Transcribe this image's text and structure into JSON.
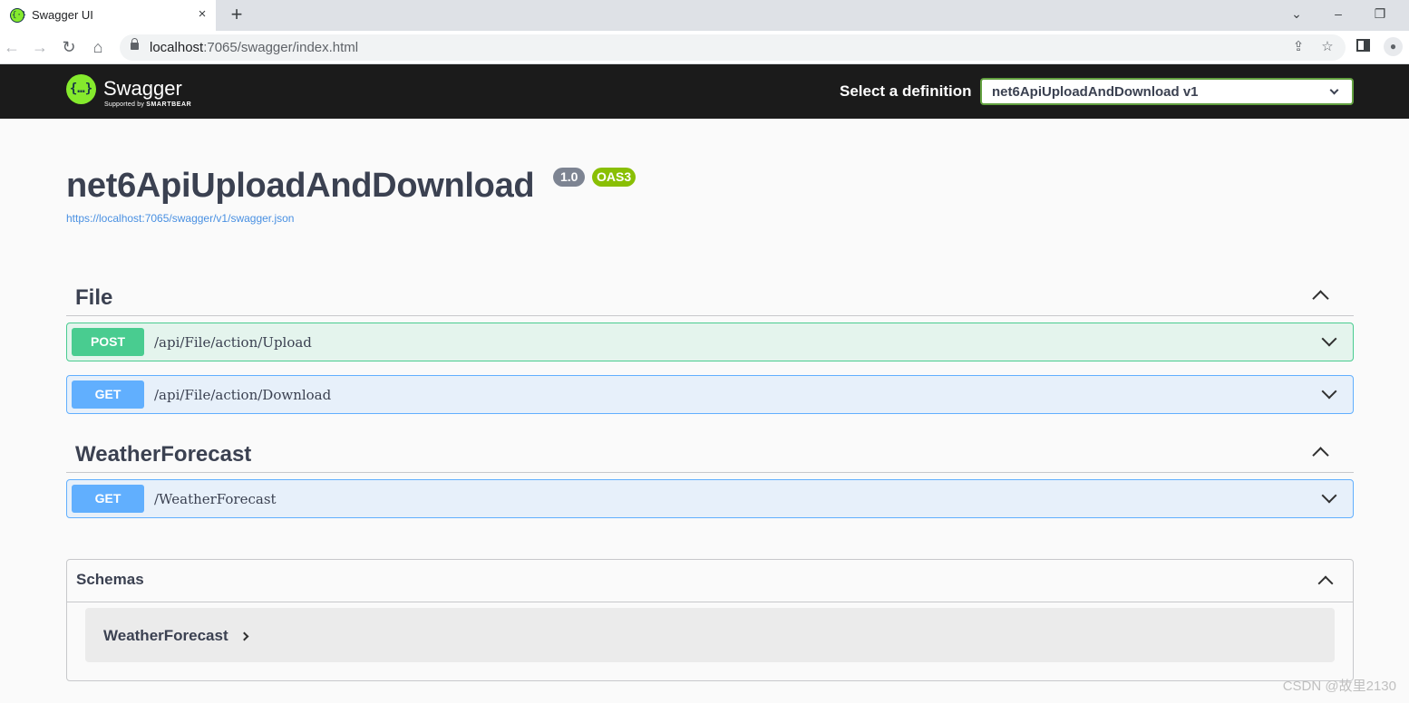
{
  "browser": {
    "tab_title": "Swagger UI",
    "tab_close": "×",
    "new_tab": "+",
    "window_controls": {
      "dropdown": "⌄",
      "minimize": "–",
      "restore": "❐"
    },
    "url_host": "localhost",
    "url_path": ":7065/swagger/index.html",
    "nav": {
      "back": "←",
      "forward": "→",
      "reload": "↻",
      "home": "⌂"
    },
    "icons": {
      "share": "⇪",
      "bookmark": "☆",
      "profile": "●"
    }
  },
  "topbar": {
    "logo_text": "Swagger",
    "logo_sub_prefix": "Supported by",
    "logo_sub_brand": "SMARTBEAR",
    "logo_mark": "{…}",
    "select_label": "Select a definition",
    "selected_definition": "net6ApiUploadAndDownload v1"
  },
  "info": {
    "title": "net6ApiUploadAndDownload",
    "version": "1.0",
    "oas": "OAS3",
    "spec_url": "https://localhost:7065/swagger/v1/swagger.json"
  },
  "tags": [
    {
      "name": "File",
      "operations": [
        {
          "method": "POST",
          "path": "/api/File/action/Upload"
        },
        {
          "method": "GET",
          "path": "/api/File/action/Download"
        }
      ]
    },
    {
      "name": "WeatherForecast",
      "operations": [
        {
          "method": "GET",
          "path": "/WeatherForecast"
        }
      ]
    }
  ],
  "schemas": {
    "title": "Schemas",
    "models": [
      "WeatherForecast"
    ]
  },
  "watermark": "CSDN @故里2130",
  "colors": {
    "post": "#49cc90",
    "get": "#61affe",
    "topbar": "#1b1b1b",
    "swagger_green": "#85ea2d",
    "oas_badge": "#89bf04",
    "version_badge": "#7d8492"
  }
}
